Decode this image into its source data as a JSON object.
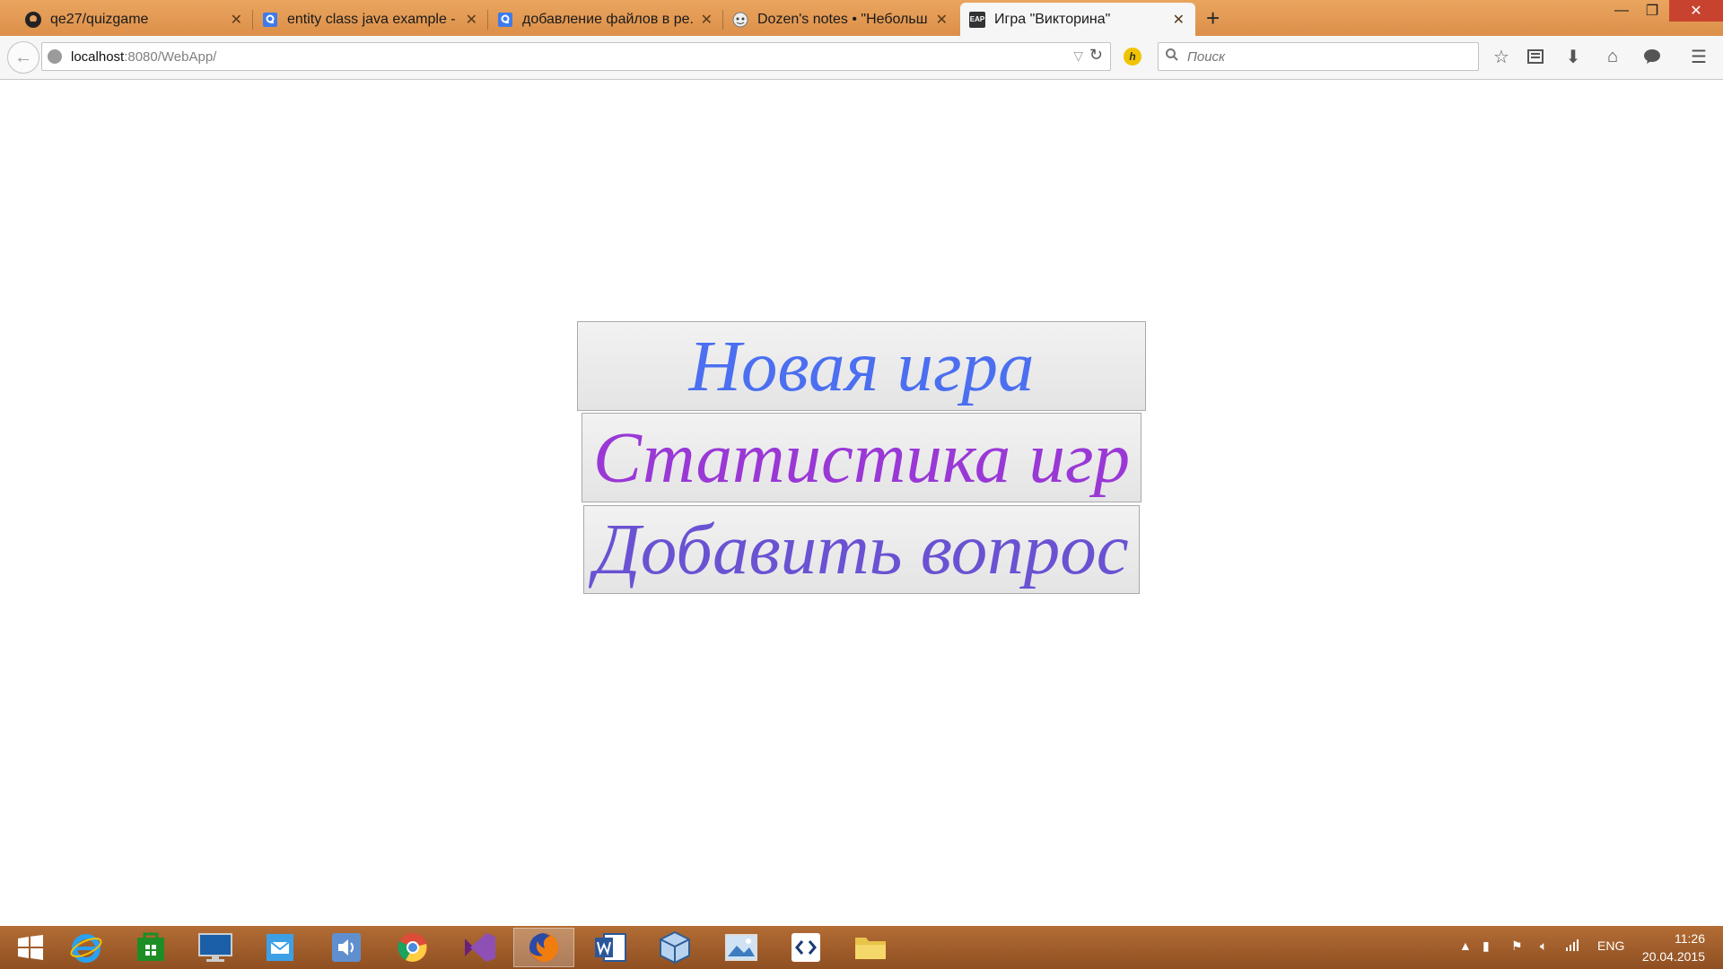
{
  "tabs": [
    {
      "title": "qe27/quizgame",
      "icon": "github-icon"
    },
    {
      "title": "entity class java example - ...",
      "icon": "google-icon"
    },
    {
      "title": "добавление файлов в ре...",
      "icon": "google-icon"
    },
    {
      "title": "Dozen's notes • \"Небольш...",
      "icon": "tumblr-icon"
    },
    {
      "title": "Игра \"Викторина\"",
      "icon": "eap-icon",
      "active": true
    }
  ],
  "tab_close_glyph": "✕",
  "new_tab_glyph": "+",
  "window_controls": {
    "minimize": "—",
    "maximize": "❐",
    "close": "✕"
  },
  "address": {
    "host": "localhost",
    "path": ":8080/WebApp/"
  },
  "search": {
    "placeholder": "Поиск"
  },
  "favicons": {
    "eap": "EAP"
  },
  "hover_glyph": "h",
  "menu": {
    "new_game": {
      "label": "Новая игра",
      "color": "#4b6ff0"
    },
    "stats": {
      "label": "Статистика игр",
      "color": "#9a38d6"
    },
    "add_question": {
      "label": "Добавить вопрос",
      "color": "#6a52d2"
    }
  },
  "taskbar": {
    "apps": [
      "windows-start-icon",
      "internet-explorer-icon",
      "store-icon",
      "remote-desktop-icon",
      "mail-icon",
      "speaker-app-icon",
      "chrome-icon",
      "visual-studio-icon",
      "firefox-icon",
      "word-icon",
      "virtualbox-icon",
      "photos-icon",
      "code-editor-icon",
      "file-explorer-icon"
    ],
    "active_app": "firefox-icon",
    "language": "ENG",
    "time": "11:26",
    "date": "20.04.2015"
  }
}
